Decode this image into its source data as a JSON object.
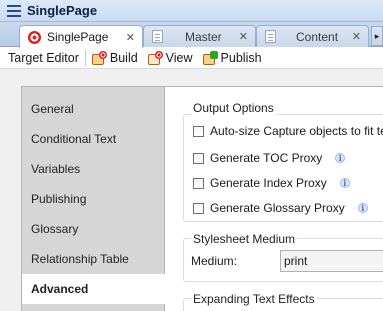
{
  "window": {
    "title": "SinglePage"
  },
  "tabs": [
    {
      "label": "SinglePage",
      "close": "✕",
      "icon": "target-icon"
    },
    {
      "label": "Master",
      "close": "✕",
      "icon": "document-icon"
    },
    {
      "label": "Content",
      "close": "✕",
      "icon": "document-icon"
    }
  ],
  "toolbar": {
    "editor_label": "Target Editor",
    "build_label": "Build",
    "view_label": "View",
    "publish_label": "Publish"
  },
  "nav": {
    "items": [
      "General",
      "Conditional Text",
      "Variables",
      "Publishing",
      "Glossary",
      "Relationship Table",
      "Advanced"
    ],
    "selected": "Advanced"
  },
  "output_options": {
    "title": "Output Options",
    "autosize_label": "Auto-size Capture objects to fit text",
    "toc_label": "Generate TOC Proxy",
    "index_label": "Generate Index Proxy",
    "glossary_label": "Generate Glossary Proxy",
    "info_glyph": "i"
  },
  "stylesheet": {
    "title": "Stylesheet Medium",
    "medium_label": "Medium:",
    "medium_value": "print"
  },
  "expanding": {
    "title": "Expanding Text Effects"
  }
}
